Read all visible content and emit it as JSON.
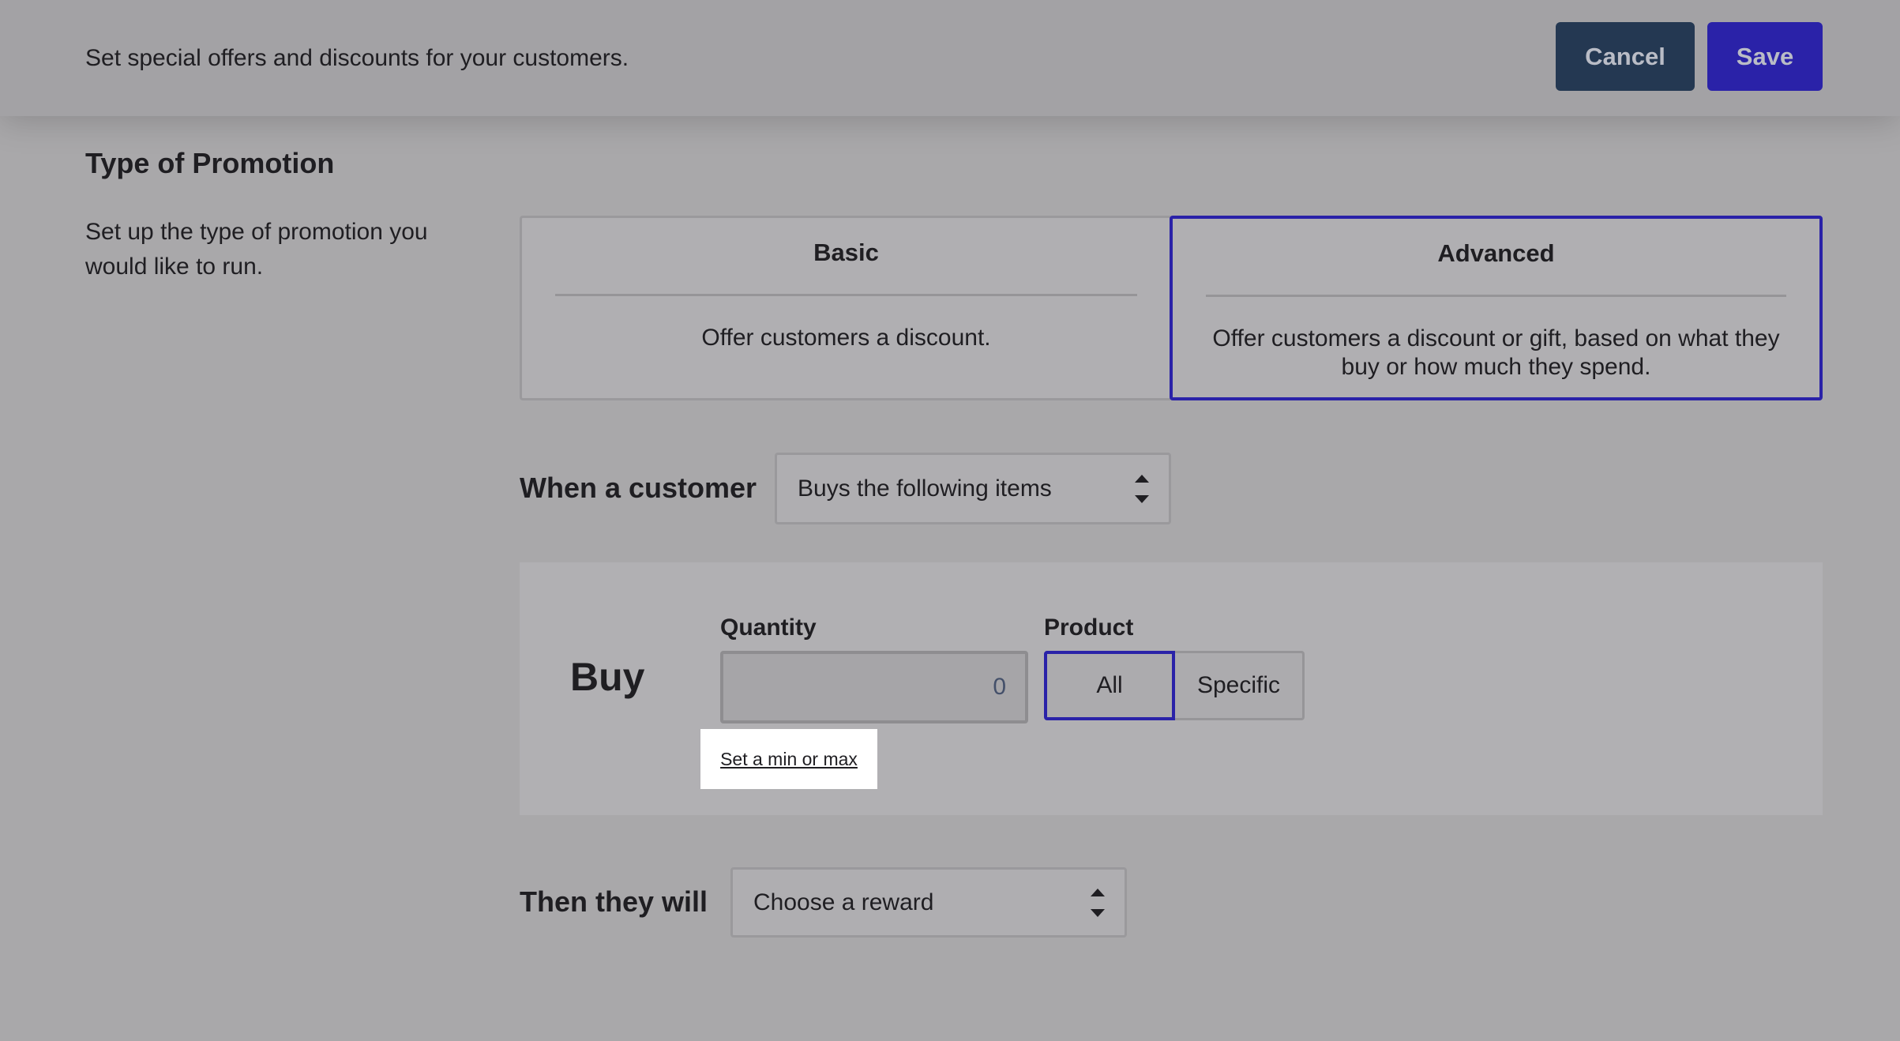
{
  "header": {
    "subtitle": "Set special offers and discounts for your customers.",
    "cancel_label": "Cancel",
    "save_label": "Save"
  },
  "promotion_type": {
    "title": "Type of Promotion",
    "description": "Set up the type of promotion you would like to run.",
    "options": [
      {
        "title": "Basic",
        "description": "Offer customers a discount.",
        "selected": false
      },
      {
        "title": "Advanced",
        "description": "Offer customers a discount or gift, based on what they buy or how much they spend.",
        "selected": true
      }
    ]
  },
  "condition": {
    "label": "When a customer",
    "selected": "Buys the following items"
  },
  "buy": {
    "label": "Buy",
    "quantity_label": "Quantity",
    "quantity_value": "0",
    "product_label": "Product",
    "product_options": [
      "All",
      "Specific"
    ],
    "product_selected": "All",
    "min_max_link": "Set a min or max"
  },
  "reward": {
    "label": "Then they will",
    "selected": "Choose a reward"
  },
  "colors": {
    "accent": "#2a22a8",
    "cancel_bg": "#243852"
  }
}
